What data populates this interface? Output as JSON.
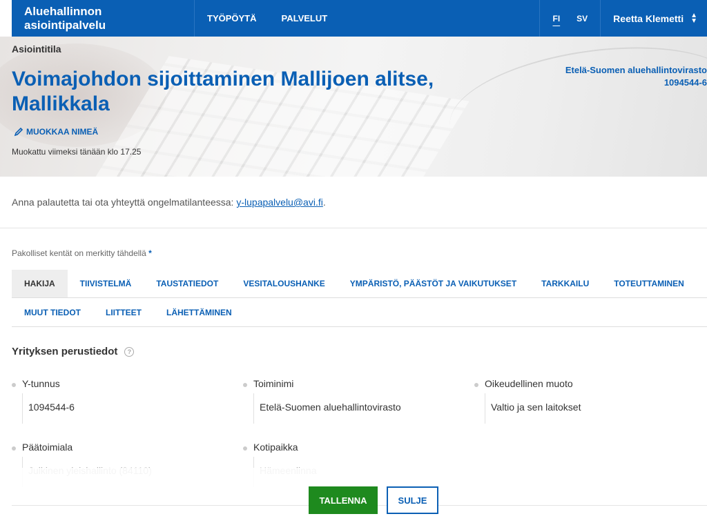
{
  "nav": {
    "brand": "Aluehallinnon asiointipalvelu",
    "links": [
      "TYÖPÖYTÄ",
      "PALVELUT"
    ],
    "languages": [
      "FI",
      "SV"
    ],
    "active_language": "FI",
    "user": "Reetta Klemetti"
  },
  "hero": {
    "breadcrumb": "Asiointitila",
    "title": "Voimajohdon sijoittaminen Mallijoen alitse, Mallikkala",
    "edit_label": "MUOKKAA NIMEÄ",
    "modified": "Muokattu viimeksi tänään klo 17.25",
    "agency_name": "Etelä-Suomen aluehallintovirasto",
    "agency_id": "1094544-6"
  },
  "feedback": {
    "text": "Anna palautetta tai ota yhteyttä ongelmatilanteessa: ",
    "email": "y-lupapalvelu@avi.fi",
    "suffix": "."
  },
  "required_note": "Pakolliset kentät on merkitty tähdellä",
  "required_mark": "*",
  "tabs_row1": [
    "HAKIJA",
    "TIIVISTELMÄ",
    "TAUSTATIEDOT",
    "VESITALOUSHANKE",
    "YMPÄRISTÖ, PÄÄSTÖT JA VAIKUTUKSET",
    "TARKKAILU",
    "TOTEUTTAMINEN"
  ],
  "tabs_row2": [
    "MUUT TIEDOT",
    "LIITTEET",
    "LÄHETTÄMINEN"
  ],
  "active_tab": "HAKIJA",
  "section": {
    "title": "Yrityksen perustiedot",
    "help": "?",
    "fields": [
      {
        "label": "Y-tunnus",
        "value": "1094544-6"
      },
      {
        "label": "Toiminimi",
        "value": "Etelä-Suomen aluehallintovirasto"
      },
      {
        "label": "Oikeudellinen muoto",
        "value": "Valtio ja sen laitokset"
      },
      {
        "label": "Päätoimiala",
        "value": "Julkinen yleishallinto (84110)"
      },
      {
        "label": "Kotipaikka",
        "value": "Hämeenlinna"
      }
    ]
  },
  "footer": {
    "save": "TALLENNA",
    "close": "SULJE"
  },
  "colors": {
    "primary": "#0a5fb4",
    "save_green": "#1e8a1e"
  }
}
